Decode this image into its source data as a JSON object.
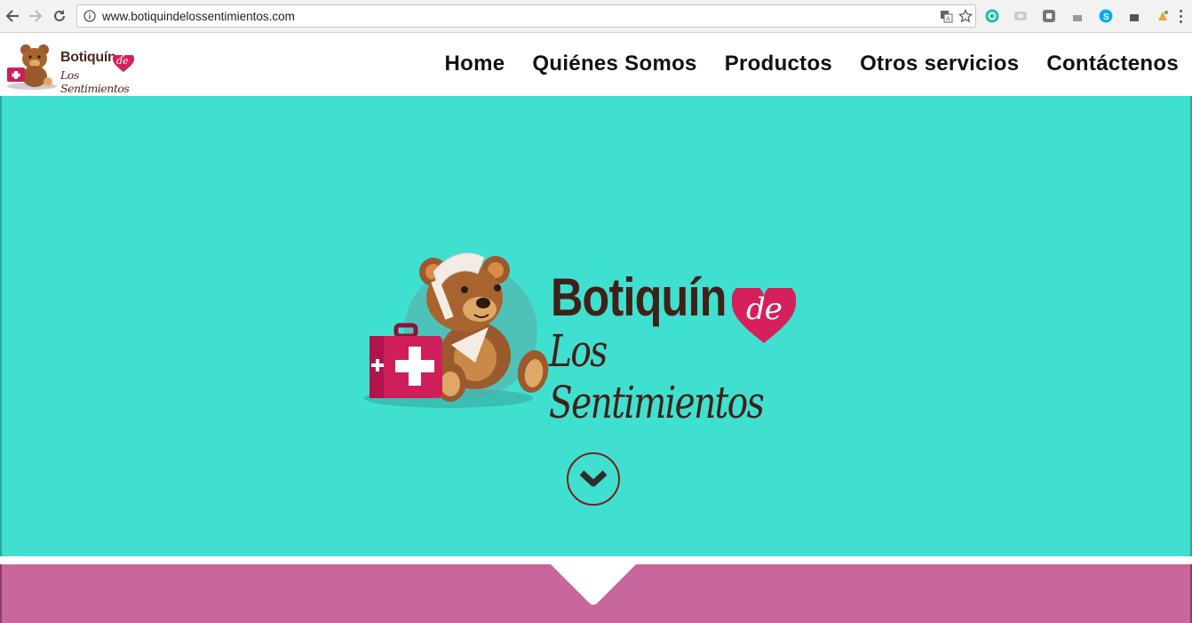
{
  "browser": {
    "url": "www.botiquindelossentimientos.com",
    "back_icon": "back-arrow-icon",
    "forward_icon": "forward-arrow-icon",
    "reload_icon": "reload-icon",
    "extensions": [
      "grammarly-icon",
      "cast-icon",
      "pocket-icon",
      "extension-icon",
      "skype-icon",
      "extension-icon",
      "puzzle-icon"
    ]
  },
  "header": {
    "logo_line1": "Botiquín",
    "logo_de": "de",
    "logo_line2": "Los Sentimientos",
    "nav": [
      "Home",
      "Quiénes Somos",
      "Productos",
      "Otros servicios",
      "Contáctenos"
    ]
  },
  "hero": {
    "brand_line1": "Botiquín",
    "brand_de": "de",
    "brand_line2": "Los Sentimientos",
    "scroll_icon": "chevron-down-icon"
  },
  "colors": {
    "hero_bg": "#40e0d0",
    "band_bg": "#c8679b",
    "brand_brown": "#40211a",
    "heart_pink": "#d6205e"
  }
}
